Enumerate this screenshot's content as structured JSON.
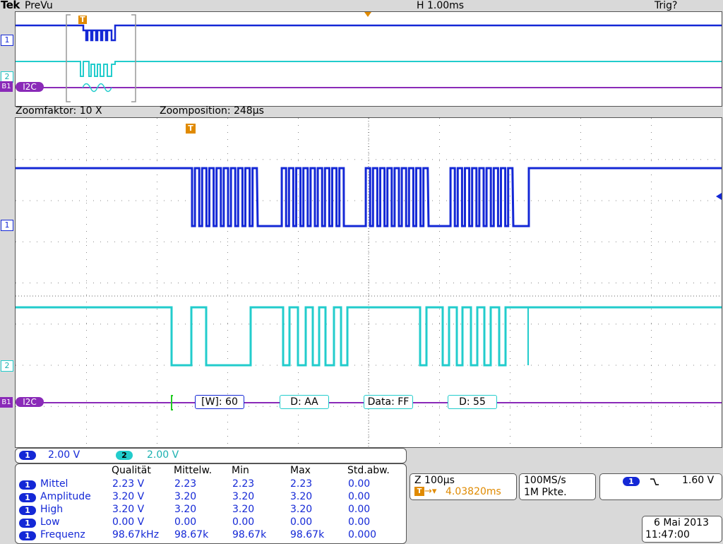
{
  "header": {
    "brand": "Tek",
    "mode": "PreVu",
    "horizontal_scale": "H 1.00ms",
    "trigger_status": "Trig?"
  },
  "zoom": {
    "factor": "Zoomfaktor: 10 X",
    "position": "Zoomposition: 248µs"
  },
  "markers": {
    "ch1": "1",
    "ch2": "2",
    "bus": "B1",
    "bus_label": "I2C",
    "trigger": "T"
  },
  "decode": [
    "[W]: 60",
    "D: AA",
    "Data: FF",
    "D: 55"
  ],
  "channels": [
    {
      "id": "1",
      "scale": "2.00 V"
    },
    {
      "id": "2",
      "scale": "2.00 V"
    }
  ],
  "measurements": {
    "headers": [
      "Qualität",
      "Mittelw.",
      "Min",
      "Max",
      "Std.abw."
    ],
    "rows": [
      {
        "ch": "1",
        "name": "Mittel",
        "value": "2.23 V",
        "mean": "2.23",
        "min": "2.23",
        "max": "2.23",
        "std": "0.00"
      },
      {
        "ch": "1",
        "name": "Amplitude",
        "value": "3.20 V",
        "mean": "3.20",
        "min": "3.20",
        "max": "3.20",
        "std": "0.00"
      },
      {
        "ch": "1",
        "name": "High",
        "value": "3.20 V",
        "mean": "3.20",
        "min": "3.20",
        "max": "3.20",
        "std": "0.00"
      },
      {
        "ch": "1",
        "name": "Low",
        "value": "0.00 V",
        "mean": "0.00",
        "min": "0.00",
        "max": "0.00",
        "std": "0.00"
      },
      {
        "ch": "1",
        "name": "Frequenz",
        "value": "98.67kHz",
        "mean": "98.67k",
        "min": "98.67k",
        "max": "98.67k",
        "std": "0.000"
      }
    ]
  },
  "zoom_box": {
    "scale": "Z 100µs",
    "delay": "4.03820ms"
  },
  "acquisition": {
    "rate": "100MS/s",
    "points": "1M Pkte."
  },
  "trigger": {
    "source": "1",
    "slope_icon": "falling-edge-icon",
    "level": "1.60 V"
  },
  "datetime": {
    "date": "6 Mai  2013",
    "time": "11:47:00"
  },
  "colors": {
    "ch1": "#1428d6",
    "ch2": "#22cccc",
    "bus": "#8a2ab8",
    "trigger": "#e08a00"
  }
}
